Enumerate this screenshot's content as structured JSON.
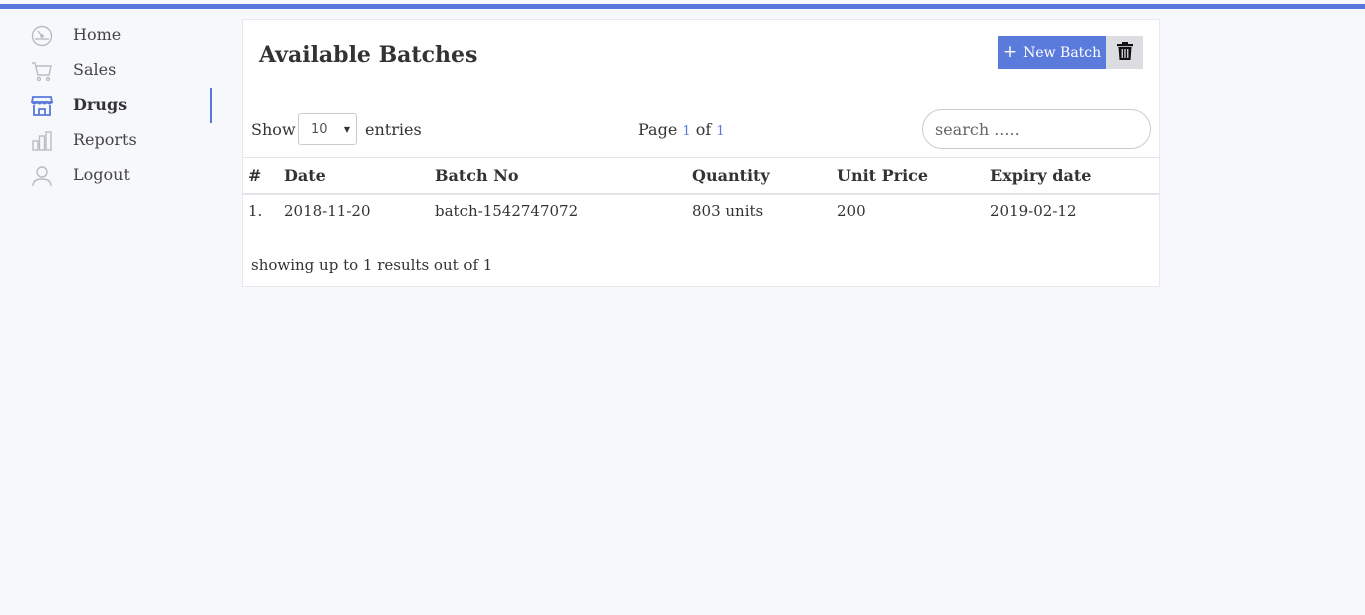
{
  "colors": {
    "accent": "#5879d9",
    "topbar": "#5879d9",
    "delete_bg": "#dcdde0"
  },
  "sidebar": {
    "items": [
      {
        "label": "Home",
        "icon": "dashboard-icon",
        "active": false
      },
      {
        "label": "Sales",
        "icon": "cart-icon",
        "active": false
      },
      {
        "label": "Drugs",
        "icon": "store-icon",
        "active": true
      },
      {
        "label": "Reports",
        "icon": "bar-chart-icon",
        "active": false
      },
      {
        "label": "Logout",
        "icon": "user-icon",
        "active": false
      }
    ]
  },
  "card": {
    "title": "Available Batches",
    "new_button": {
      "icon": "plus-icon",
      "label": "New Batch"
    },
    "delete_button": {
      "icon": "trash-icon"
    },
    "show_label": "Show",
    "entries_value": "10",
    "entries_label": "entries",
    "pager": {
      "prefix": "Page",
      "current": "1",
      "of": "of",
      "total": "1"
    },
    "search": {
      "placeholder": "search .....",
      "value": ""
    },
    "table": {
      "headers": [
        "#",
        "Date",
        "Batch No",
        "Quantity",
        "Unit Price",
        "Expiry date"
      ],
      "rows": [
        [
          "1.",
          "2018-11-20",
          "batch-1542747072",
          "803 units",
          "200",
          "2019-02-12"
        ]
      ]
    },
    "footer": "showing up to 1 results out of 1"
  }
}
